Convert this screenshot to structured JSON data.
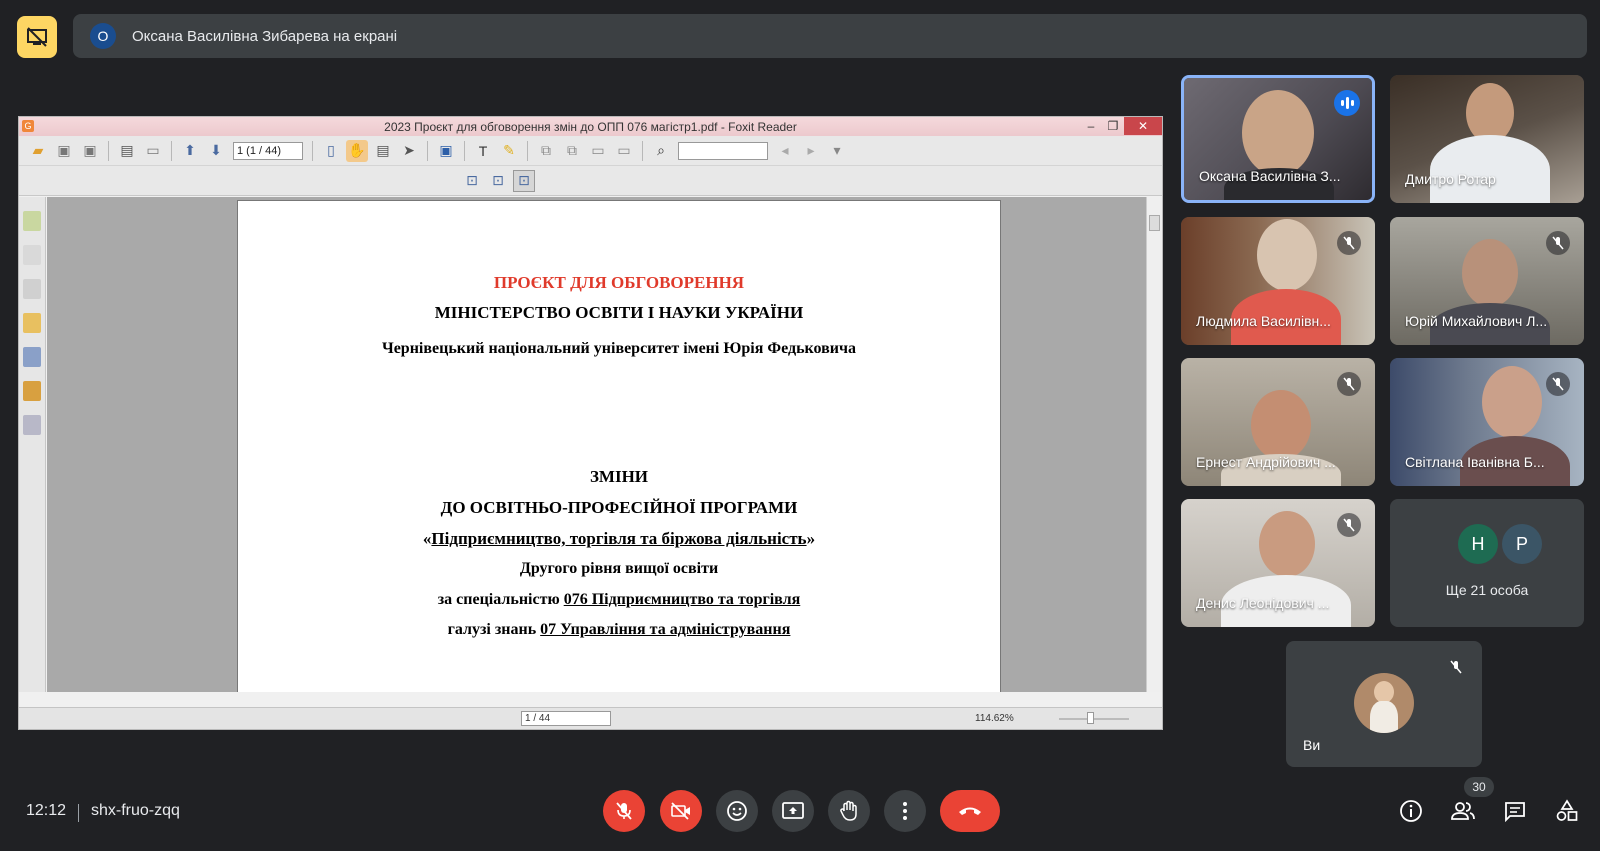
{
  "banner": {
    "avatar_letter": "О",
    "text": "Оксана Василівна Зибарева на екрані"
  },
  "foxit": {
    "title": "2023 Проєкт для обговорення змін до  ОПП 076 магістр1.pdf - Foxit Reader",
    "page_field": "1 (1 / 44)",
    "status_page": "1 / 44",
    "zoom": "114.62%",
    "document": {
      "line1": "ПРОЄКТ ДЛЯ ОБГОВОРЕННЯ",
      "line2": "МІНІСТЕРСТВО ОСВІТИ І НАУКИ УКРАЇНИ",
      "line3": "Чернівецький національний університет імені Юрія Федьковича",
      "line4": "ЗМІНИ",
      "line5": "ДО ОСВІТНЬО-ПРОФЕСІЙНОЇ ПРОГРАМИ",
      "line6_open": "«",
      "line6_title": "Підприємництво, торгівля та біржова діяльність",
      "line6_close": "»",
      "line7": "Другого рівня вищої освіти",
      "line8_prefix": "за спеціальністю ",
      "line8_value": "076 Підприємництво та торгівля",
      "line9_prefix": "галузі знань ",
      "line9_value": "07 Управління та адміністрування"
    }
  },
  "participants": [
    {
      "name": "Оксана Василівна З...",
      "speaking": true
    },
    {
      "name": "Дмитро Ротар",
      "muted": false
    },
    {
      "name": "Людмила Василівн...",
      "muted": true
    },
    {
      "name": "Юрій Михайлович Л...",
      "muted": true
    },
    {
      "name": "Ернест Андрійович ...",
      "muted": true
    },
    {
      "name": "Світлана Іванівна Б...",
      "muted": true
    },
    {
      "name": "Денис Леонідович ...",
      "muted": true
    }
  ],
  "more": {
    "avatars": [
      {
        "letter": "Н",
        "color": "#1e6b52"
      },
      {
        "letter": "Р",
        "color": "#3b5566"
      }
    ],
    "label": "Ще 21 особа"
  },
  "self": {
    "name": "Ви",
    "muted": true
  },
  "bottom": {
    "time": "12:12",
    "meeting_code": "shx-fruo-zqq",
    "participant_count": "30"
  },
  "icons": {
    "present": "stop-presenting-icon",
    "mic": "mic-off-icon",
    "camera": "camera-off-icon",
    "emoji": "emoji-icon",
    "share": "present-screen-icon",
    "hand": "raise-hand-icon",
    "more": "more-options-icon",
    "leave": "leave-call-icon",
    "info": "info-icon",
    "people": "people-icon",
    "chat": "chat-icon",
    "activities": "activities-icon"
  },
  "colors": {
    "accent": "#8ab4f8",
    "danger": "#ea4335",
    "present_yellow": "#fdd663",
    "doc_red": "#e03a2b"
  }
}
